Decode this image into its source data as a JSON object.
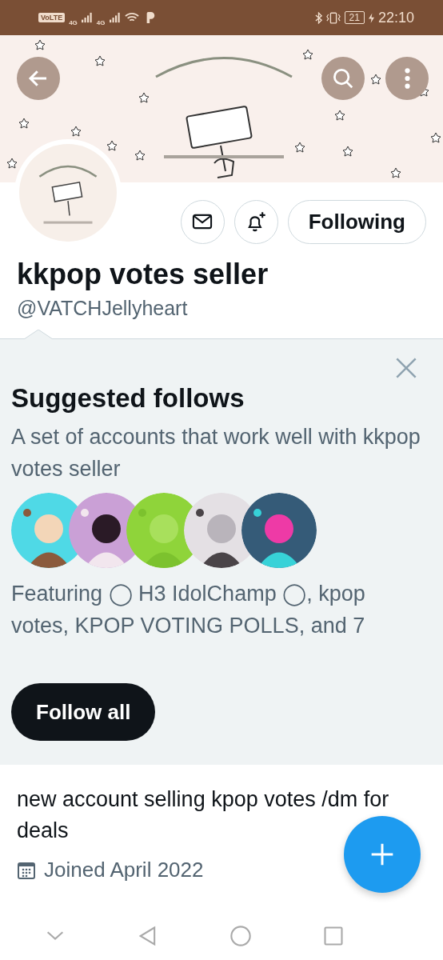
{
  "status_bar": {
    "volte": "VoLTE",
    "signals": [
      "4G",
      "4G"
    ],
    "battery": "21",
    "time": "22:10"
  },
  "profile": {
    "actions": [
      {
        "kind": "mail"
      },
      {
        "kind": "bell"
      }
    ],
    "follow_button": "Following",
    "name": "kkpop votes seller",
    "handle": "@VATCHJellyheart",
    "bio": "new account selling kpop votes /dm for deals",
    "joined": "Joined April 2022"
  },
  "suggested": {
    "title": "Suggested follows",
    "description": "A set of accounts that work well with kkpop votes seller",
    "featuring": "Featuring ◯ H3 IdolChamp ◯, kpop votes, KPOP VOTING POLLS, and 7",
    "button": "Follow all"
  }
}
